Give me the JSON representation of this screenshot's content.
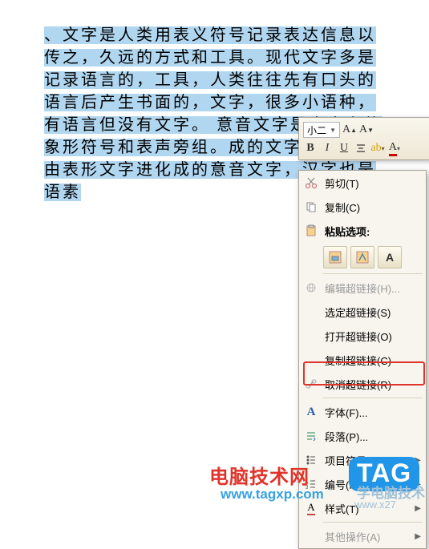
{
  "document": {
    "selected_text": "、文字是人类用表义符号记录表达信息以传之，久远的方式和工具。现代文字多是记录语言的，工具，人类往往先有口头的语言后产生书面的，文字，很多小语种，有语言但没有文字。 意音文字是由表义的象形符号和表声旁组。成的文字，汉字是由表形文字进化成的意音文字，汉字也是语素"
  },
  "mini_toolbar": {
    "font_size": "小二"
  },
  "context_menu": {
    "cut": "剪切(T)",
    "copy": "复制(C)",
    "paste_heading": "粘贴选项:",
    "edit_hyperlink": "编辑超链接(H)...",
    "select_hyperlink": "选定超链接(S)",
    "open_hyperlink": "打开超链接(O)",
    "copy_hyperlink": "复制超链接(C)",
    "remove_hyperlink": "取消超链接(R)",
    "font": "字体(F)...",
    "paragraph": "段落(P)...",
    "bullets": "项目符号(B)",
    "numbering": "编号(N)",
    "styles": "样式(T)",
    "other_actions": "其他操作(A)"
  },
  "watermarks": {
    "site_zh": "电脑技术网",
    "tag": "TAG",
    "site_zh2": "学电脑技术",
    "url1": "www.tagxp.com",
    "url2": "www.x27"
  }
}
